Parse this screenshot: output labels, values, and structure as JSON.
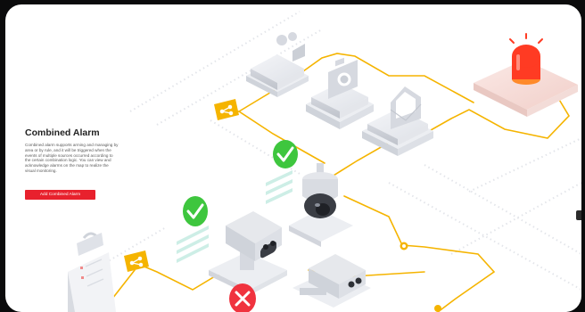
{
  "intro": {
    "title": "Combined Alarm",
    "description": "Combined alarm supports arming and managing by area or by rule, and it will be triggered when the events of multiple sources occurred according to the certain combination logic. You can view and acknowledge alarms on the map to realize the visual monitoring.",
    "button_label": "Add Combined Alarm"
  },
  "colors": {
    "accent": "#e8212d",
    "wire": "#f5b400",
    "check": "#3ec63e",
    "alarm_light": "#ff3b23"
  },
  "icons": [
    "video-camera-icon",
    "photo-camera-icon",
    "envelope-icon",
    "alarm-light-icon",
    "share-icon",
    "check-icon",
    "close-icon",
    "document-icon"
  ]
}
